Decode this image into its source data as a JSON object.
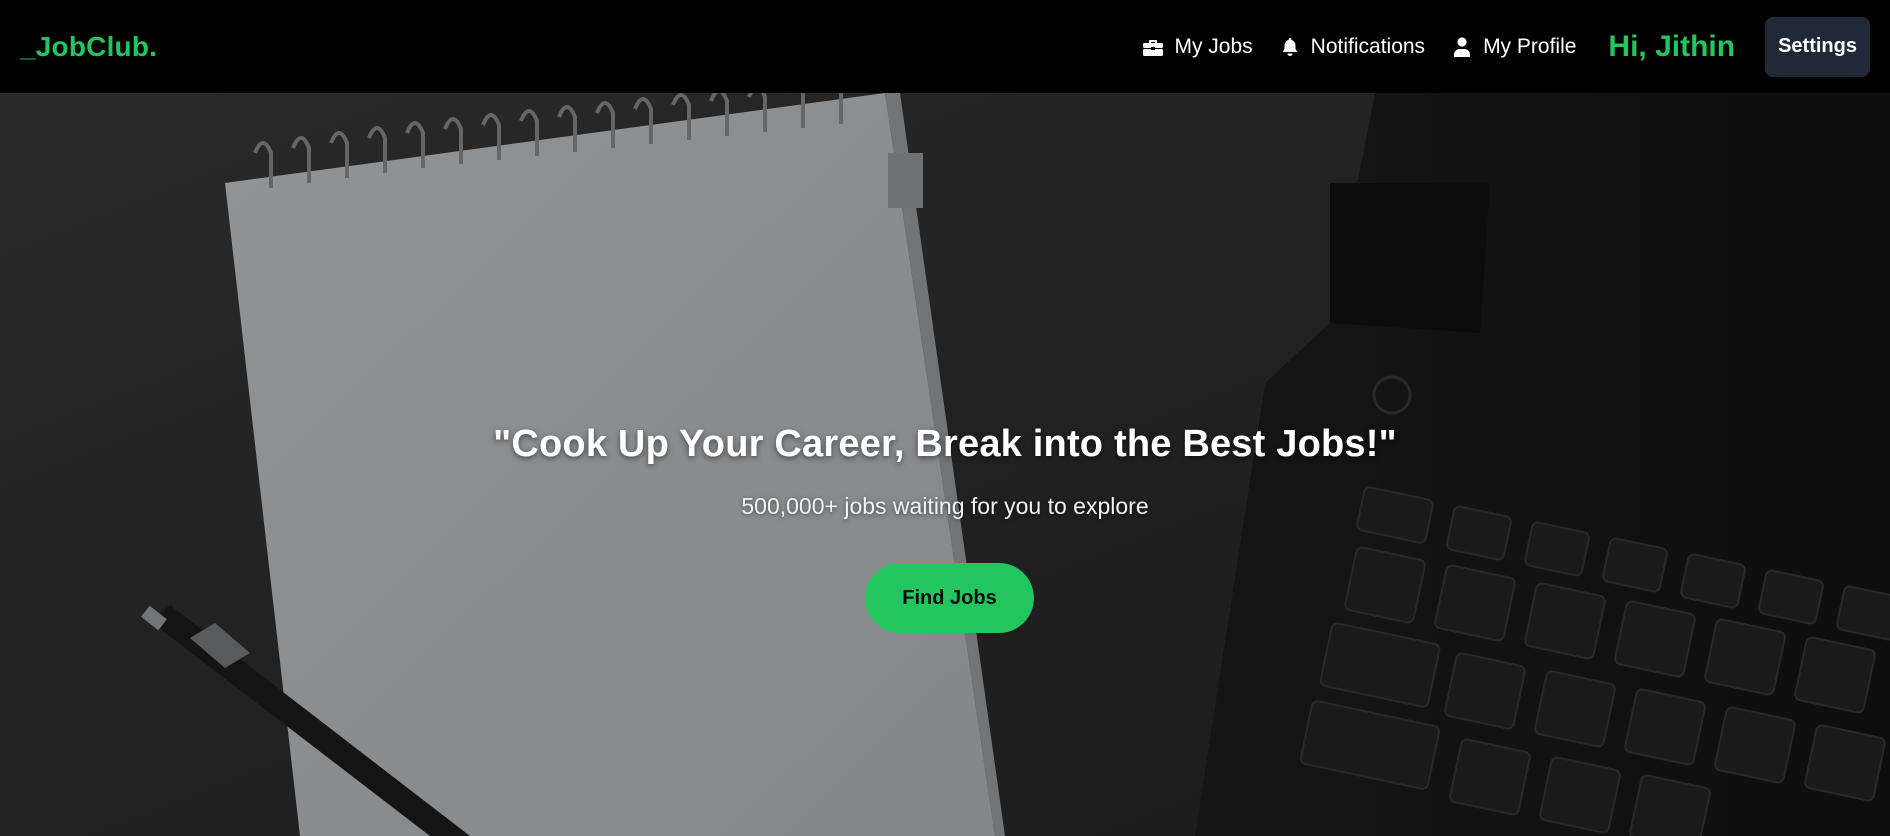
{
  "brand": {
    "logo": "_JobClub."
  },
  "nav": {
    "links": [
      {
        "label": "My Jobs",
        "icon": "briefcase-icon"
      },
      {
        "label": "Notifications",
        "icon": "bell-icon"
      },
      {
        "label": "My Profile",
        "icon": "user-icon"
      }
    ],
    "greeting": "Hi, Jithin",
    "settings_label": "Settings"
  },
  "hero": {
    "headline": "\"Cook Up Your Career, Break into the Best Jobs!\"",
    "subtitle": "500,000+ jobs waiting for you to explore",
    "cta_label": "Find Jobs"
  },
  "colors": {
    "accent": "#22c55e",
    "navbar_bg": "#000000",
    "settings_bg": "#1f2937"
  }
}
